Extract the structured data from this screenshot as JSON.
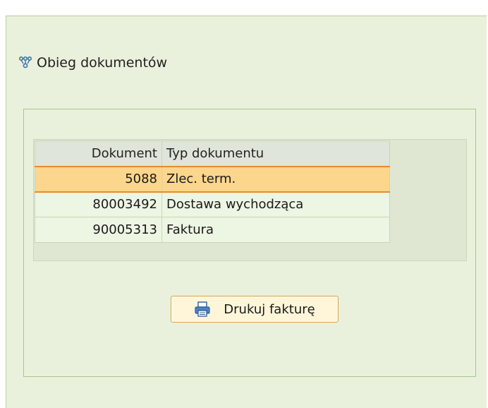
{
  "panel": {
    "title": "Obieg dokumentów",
    "title_icon": "document-flow-icon"
  },
  "table": {
    "columns": [
      "Dokument",
      "Typ dokumentu"
    ],
    "rows": [
      {
        "document": "5088",
        "type": "Zlec. term.",
        "selected": true
      },
      {
        "document": "80003492",
        "type": "Dostawa wychodząca",
        "selected": false
      },
      {
        "document": "90005313",
        "type": "Faktura",
        "selected": false
      }
    ]
  },
  "actions": {
    "print_invoice_label": "Drukuj fakturę",
    "print_icon": "printer-icon"
  },
  "colors": {
    "panel_background": "#e9f1dc",
    "selected_row": "#fcd68c",
    "selected_border": "#e98a2c",
    "button_border": "#d3a64b"
  }
}
